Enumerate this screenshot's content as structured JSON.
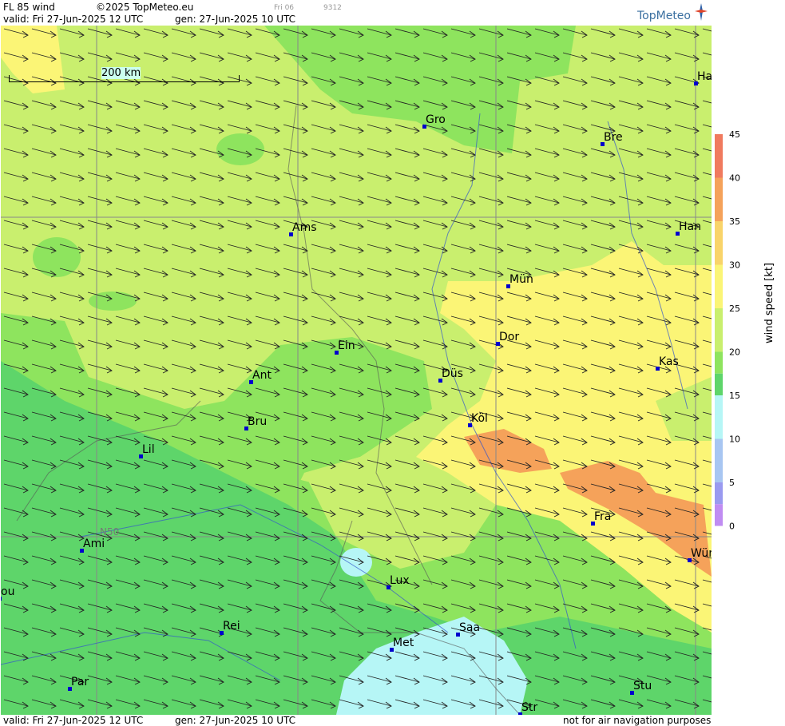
{
  "header": {
    "title": "FL 85 wind",
    "copyright": "©2025 TopMeteo.eu",
    "run_hour": "Fri 06",
    "run_code": "9312",
    "valid": "valid:  Fri  27-Jun-2025  12 UTC",
    "gen": "gen: 27-Jun-2025 10 UTC",
    "logo": "TopMeteo"
  },
  "footer": {
    "valid": "valid:  Fri  27-Jun-2025  12 UTC",
    "gen": "gen: 27-Jun-2025 10 UTC",
    "disclaimer": "not for air navigation purposes"
  },
  "map": {
    "scale_label": "200 km",
    "lat_label": "N50",
    "cities": [
      {
        "name": "Ha"
      },
      {
        "name": "Gro"
      },
      {
        "name": "Bre"
      },
      {
        "name": "Ams"
      },
      {
        "name": "Han"
      },
      {
        "name": "Mün"
      },
      {
        "name": "Dor"
      },
      {
        "name": "Ein"
      },
      {
        "name": "Kas"
      },
      {
        "name": "Ant"
      },
      {
        "name": "Düs"
      },
      {
        "name": "Köl"
      },
      {
        "name": "Bru"
      },
      {
        "name": "Lil"
      },
      {
        "name": "Fra"
      },
      {
        "name": "Ami"
      },
      {
        "name": "Wür"
      },
      {
        "name": "Lux"
      },
      {
        "name": "Rei"
      },
      {
        "name": "Saa"
      },
      {
        "name": "Met"
      },
      {
        "name": "ou"
      },
      {
        "name": "Par"
      },
      {
        "name": "Stu"
      },
      {
        "name": "Str"
      }
    ]
  },
  "legend": {
    "label": "wind  speed  [kt]",
    "ticks": [
      "45",
      "40",
      "35",
      "30",
      "25",
      "20",
      "15",
      "10",
      "5",
      "0"
    ],
    "colors": [
      "#f07a5e",
      "#f5a25a",
      "#f9d46a",
      "#fbf576",
      "#c9ef6e",
      "#8ee45e",
      "#5ed56a",
      "#b6f6f6",
      "#a8c6f2",
      "#9a9af0",
      "#c08cf2"
    ]
  }
}
